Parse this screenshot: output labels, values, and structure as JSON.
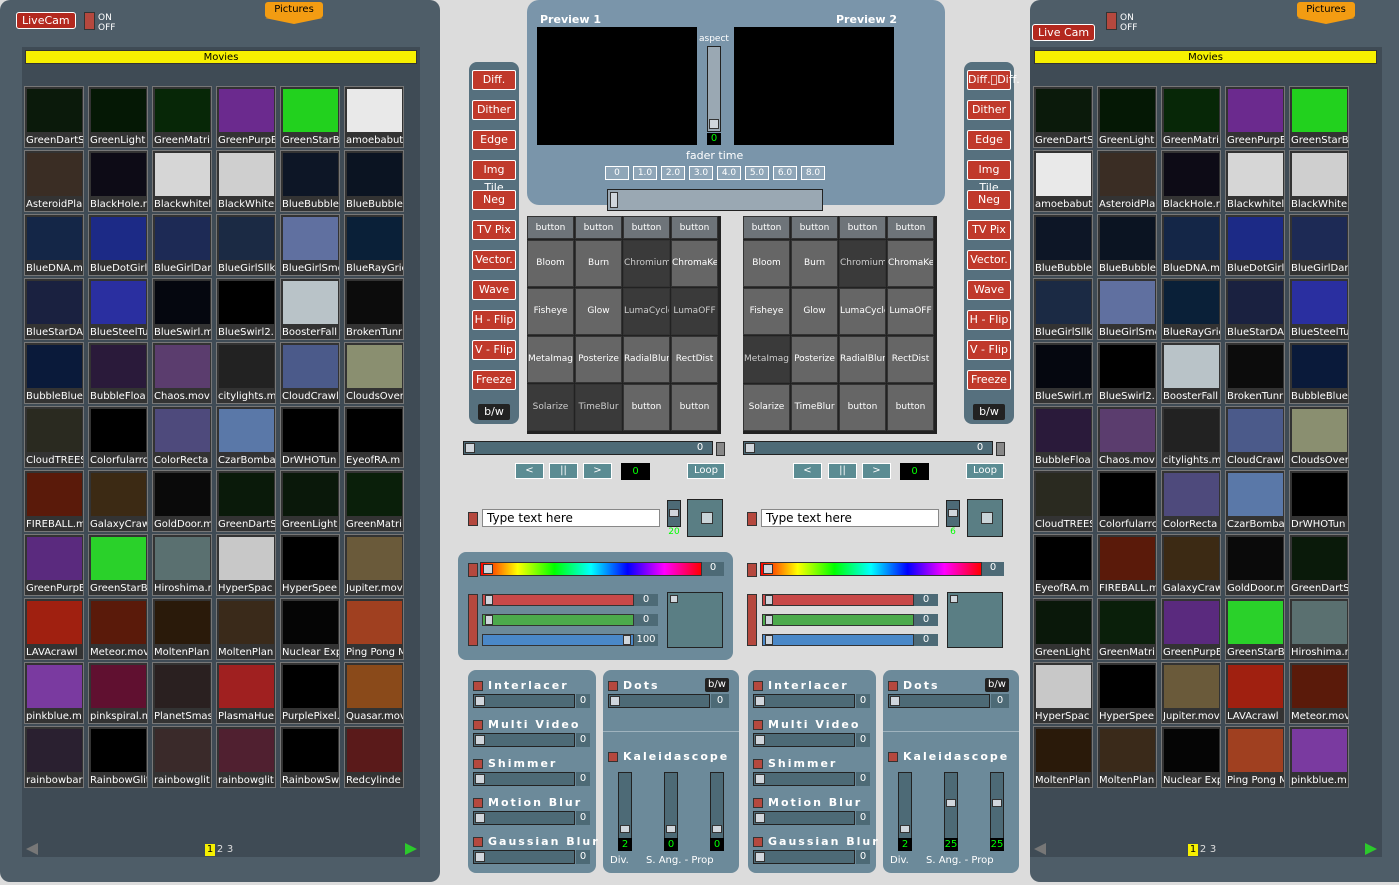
{
  "left_library": {
    "livecam_label": "LiveCam",
    "on_label": "ON",
    "off_label": "OFF",
    "pictures_label": "Pictures",
    "movies_label": "Movies",
    "thumbs": [
      "GreenDartS",
      "GreenLight",
      "GreenMatri",
      "GreenPurpE",
      "GreenStarB",
      "amoebabut",
      "AsteroidPla",
      "BlackHole.r",
      "Blackwhitel",
      "BlackWhite",
      "BlueBubble",
      "BlueBubble",
      "BlueDNA.m",
      "BlueDotGirl",
      "BlueGirlDan",
      "BlueGirlSllk.",
      "BlueGirlSmo",
      "BlueRayGric",
      "BlueStarDA",
      "BlueSteelTu",
      "BlueSwirl.m",
      "BlueSwirl2.",
      "BoosterFall",
      "BrokenTunr",
      "BubbleBlue",
      "BubbleFloa",
      "Chaos.mov",
      "citylights.m",
      "CloudCrawl",
      "CloudsOver",
      "CloudTREES",
      "Colorfularrc",
      "ColorRecta",
      "CzarBomba",
      "DrWHOTun",
      "EyeofRA.m",
      "FIREBALL.m",
      "GalaxyCraw",
      "GoldDoor.m",
      "GreenDartS",
      "GreenLight",
      "GreenMatri",
      "GreenPurpE",
      "GreenStarB",
      "Hiroshima.r",
      "HyperSpac",
      "HyperSpee",
      "Jupiter.mov",
      "LAVAcrawl",
      "Meteor.mov",
      "MoltenPlan",
      "MoltenPlan",
      "Nuclear Exp",
      "Ping Pong M",
      "pinkblue.m",
      "pinkspiral.m",
      "PlanetSmas",
      "PlasmaHue",
      "PurplePixel.",
      "Quasar.mov",
      "rainbowbar",
      "RainbowGlit",
      "rainbowglit",
      "rainbowglit",
      "RainbowSw",
      "Redcylinde"
    ],
    "thumb_colors": [
      "#0b1a0b",
      "#051805",
      "#072707",
      "#6b2a8e",
      "#22d11e",
      "#e9e9e9",
      "#3a2d24",
      "#0d0b16",
      "#d6d6d6",
      "#cfcfcf",
      "#0d1626",
      "#0b1422",
      "#142647",
      "#1c2a86",
      "#1d2a55",
      "#1b2a44",
      "#6070a0",
      "#0a2038",
      "#1a2140",
      "#2a2fa0",
      "#05070f",
      "#000000",
      "#b9c3c8",
      "#0c0c0c",
      "#0a1a3a",
      "#2a1a3a",
      "#5b3d6e",
      "#222222",
      "#4b5a8a",
      "#8a8f70",
      "#2a2a20",
      "#000000",
      "#4e4a7c",
      "#5a78a8",
      "#000000",
      "#000000",
      "#5a1a0a",
      "#3c2a14",
      "#0a0a0a",
      "#0a1a0a",
      "#0a180a",
      "#0a1f0a",
      "#5a2a7e",
      "#2ad12a",
      "#5a7070",
      "#c8c8c8",
      "#000000",
      "#6a5a3a",
      "#a02010",
      "#5a1a0a",
      "#2a1a0a",
      "#3a2a1a",
      "#050505",
      "#a04020",
      "#7a3aa0",
      "#601030",
      "#2a2020",
      "#a02020",
      "#000000",
      "#8a4a1a",
      "#2a2030",
      "#000000",
      "#3a2a2a",
      "#502030",
      "#000000",
      "#5a1a1a"
    ],
    "pages": [
      "1",
      "2",
      "3"
    ]
  },
  "right_library": {
    "livecam_label": "Live Cam",
    "on_label": "ON",
    "off_label": "OFF",
    "pictures_label": "Pictures",
    "movies_label": "Movies",
    "thumbs": [
      "GreenDartS",
      "GreenLight",
      "GreenMatri",
      "GreenPurpE",
      "GreenStarB",
      "amoebabut",
      "AsteroidPla",
      "BlackHole.r",
      "Blackwhitel",
      "BlackWhite",
      "BlueBubble",
      "BlueBubble",
      "BlueDNA.m",
      "BlueDotGirl",
      "BlueGirlDan",
      "BlueGirlSllk.",
      "BlueGirlSmo",
      "BlueRayGric",
      "BlueStarDA",
      "BlueSteelTu",
      "BlueSwirl.m",
      "BlueSwirl2.",
      "BoosterFall",
      "BrokenTunr",
      "BubbleBlue",
      "BubbleFloa",
      "Chaos.mov",
      "citylights.m",
      "CloudCrawl",
      "CloudsOver",
      "CloudTREES",
      "Colorfularrc",
      "ColorRecta",
      "CzarBomba",
      "DrWHOTun",
      "EyeofRA.m",
      "FIREBALL.m",
      "GalaxyCraw",
      "GoldDoor.m",
      "GreenDartS",
      "GreenLight",
      "GreenMatri",
      "GreenPurpE",
      "GreenStarB",
      "Hiroshima.r",
      "HyperSpac",
      "HyperSpee",
      "Jupiter.mov",
      "LAVAcrawl",
      "Meteor.mov",
      "MoltenPlan",
      "MoltenPlan",
      "Nuclear Exp",
      "Ping Pong M",
      "pinkblue.m"
    ],
    "thumb_colors": [
      "#0b1a0b",
      "#051805",
      "#072707",
      "#6b2a8e",
      "#22d11e",
      "#e9e9e9",
      "#3a2d24",
      "#0d0b16",
      "#d6d6d6",
      "#cfcfcf",
      "#0d1626",
      "#0b1422",
      "#142647",
      "#1c2a86",
      "#1d2a55",
      "#1b2a44",
      "#6070a0",
      "#0a2038",
      "#1a2140",
      "#2a2fa0",
      "#05070f",
      "#000000",
      "#b9c3c8",
      "#0c0c0c",
      "#0a1a3a",
      "#2a1a3a",
      "#5b3d6e",
      "#222222",
      "#4b5a8a",
      "#8a8f70",
      "#2a2a20",
      "#000000",
      "#4e4a7c",
      "#5a78a8",
      "#000000",
      "#000000",
      "#5a1a0a",
      "#3c2a14",
      "#0a0a0a",
      "#0a1a0a",
      "#0a180a",
      "#0a1f0a",
      "#5a2a7e",
      "#2ad12a",
      "#5a7070",
      "#c8c8c8",
      "#000000",
      "#6a5a3a",
      "#a02010",
      "#5a1a0a",
      "#2a1a0a",
      "#3a2a1a",
      "#050505",
      "#a04020",
      "#7a3aa0"
    ],
    "pages": [
      "1",
      "2",
      "3"
    ]
  },
  "fx_left": [
    "Diff.",
    "Dither",
    "Edge",
    "Img Tile",
    "Neg",
    "TV Pix",
    "Vector.",
    "Wave",
    "H - Flip",
    "V - Flip",
    "Freeze"
  ],
  "fx_right": [
    "Diff.\u0000Diff.",
    "Dither",
    "Edge",
    "Img Tile",
    "Neg",
    "TV Pix",
    "Vector.",
    "Wave",
    "H - Flip",
    "V - Flip",
    "Freeze"
  ],
  "bw_label": "b/w",
  "preview": {
    "preview1": "Preview 1",
    "preview2": "Preview 2",
    "aspect_label": "aspect",
    "aspect_value": "0",
    "fader_time_label": "fader time",
    "fader_times": [
      "0",
      "1.0",
      "2.0",
      "3.0",
      "4.0",
      "5.0",
      "6.0",
      "8.0"
    ]
  },
  "effects_left": [
    [
      "button",
      "button",
      "button",
      "button"
    ],
    [
      "Bloom",
      "Burn",
      "Chromium",
      "ChromaKey"
    ],
    [
      "Fisheye",
      "Glow",
      "LumaCycle",
      "LumaOFF"
    ],
    [
      "MetaImage",
      "Posterize",
      "RadialBlur",
      "RectDist"
    ],
    [
      "Solarize",
      "TimeBlur",
      "button",
      "button"
    ]
  ],
  "effects_right": [
    [
      "button",
      "button",
      "button",
      "button"
    ],
    [
      "Bloom",
      "Burn",
      "Chromium",
      "ChromaKey"
    ],
    [
      "Fisheye",
      "Glow",
      "LumaCycle",
      "LumaOFF"
    ],
    [
      "MetaImage",
      "Posterize",
      "RadialBlur",
      "RectDist"
    ],
    [
      "Solarize",
      "TimeBlur",
      "button",
      "button"
    ]
  ],
  "deck_left": {
    "position_value": "0",
    "prev": "<",
    "pause": "||",
    "next": ">",
    "frame_value": "0",
    "loop": "Loop",
    "text_placeholder": "Type text here",
    "text_size": "20",
    "hue_value": "0",
    "red_value": "0",
    "green_value": "0",
    "blue_value": "100"
  },
  "deck_right": {
    "position_value": "0",
    "prev": "<",
    "pause": "||",
    "next": ">",
    "frame_value": "0",
    "loop": "Loop",
    "text_placeholder": "Type text here",
    "text_size": "6",
    "hue_value": "0",
    "red_value": "0",
    "green_value": "0",
    "blue_value": "0"
  },
  "post_left": {
    "interlacer": "Interlacer",
    "interlacer_v": "0",
    "multi": "Multi Video",
    "multi_v": "0",
    "shimmer": "Shimmer",
    "shimmer_v": "0",
    "motion": "Motion Blur",
    "motion_v": "0",
    "gauss": "Gaussian Blur",
    "gauss_v": "0",
    "dots": "Dots",
    "dots_v": "0",
    "kaleido": "Kaleidascope",
    "div_v": "2",
    "ang_v": "0",
    "prop_v": "0",
    "div_label": "Div.",
    "ang_label": "S. Ang. - Prop"
  },
  "post_right": {
    "interlacer": "Interlacer",
    "interlacer_v": "0",
    "multi": "Multi Video",
    "multi_v": "0",
    "shimmer": "Shimmer",
    "shimmer_v": "0",
    "motion": "Motion Blur",
    "motion_v": "0",
    "gauss": "Gaussian Blur",
    "gauss_v": "0",
    "dots": "Dots",
    "dots_v": "0",
    "kaleido": "Kaleidascope",
    "div_v": "2",
    "ang_v": "25",
    "prop_v": "25",
    "div_label": "Div.",
    "ang_label": "S. Ang. - Prop"
  }
}
